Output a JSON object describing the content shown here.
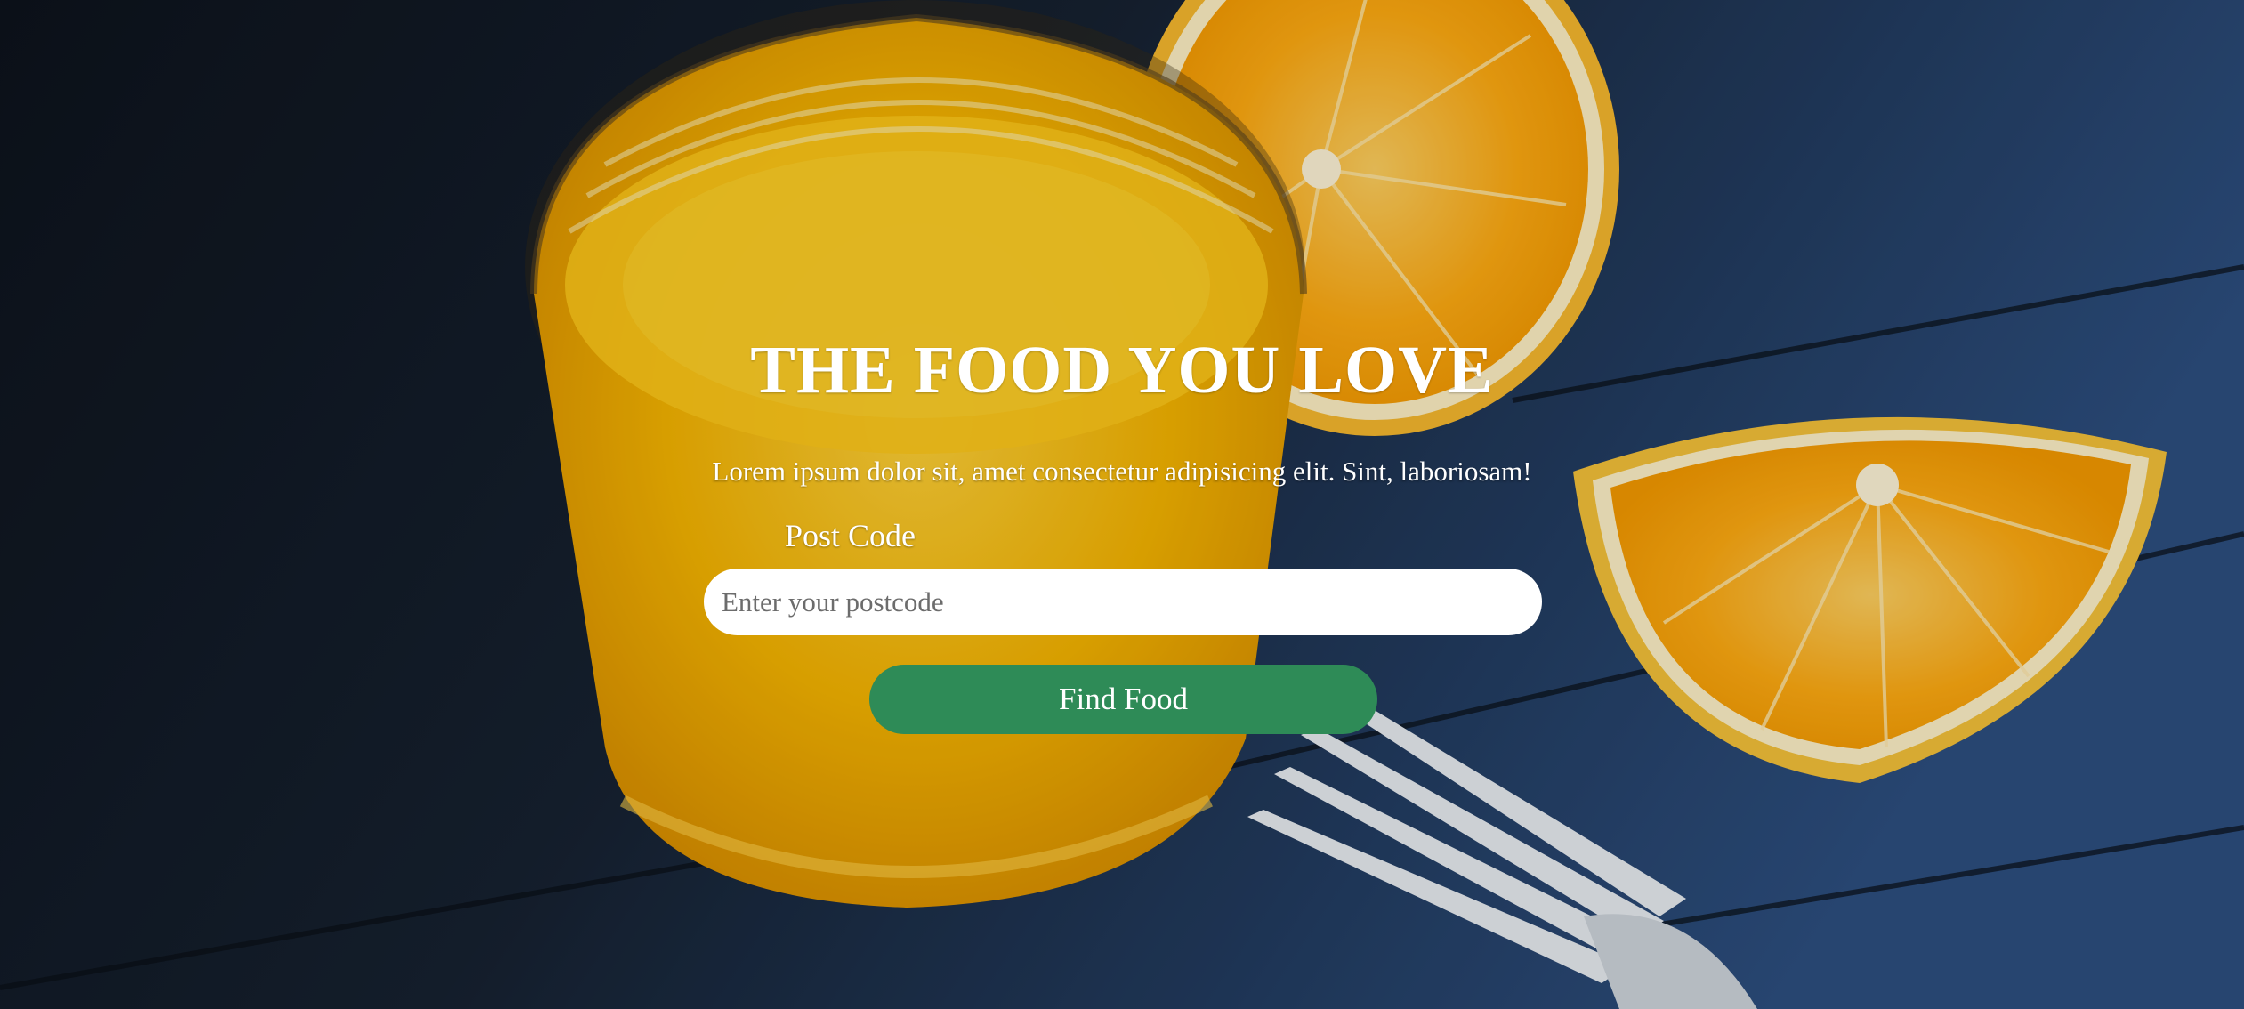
{
  "hero": {
    "title": "THE FOOD YOU LOVE",
    "subtitle": "Lorem ipsum dolor sit, amet consectetur adipisicing elit. Sint, laboriosam!"
  },
  "search_form": {
    "postcode_label": "Post Code",
    "postcode_placeholder": "Enter your postcode",
    "postcode_value": "",
    "submit_label": "Find Food"
  },
  "colors": {
    "button_green": "#2e8b57",
    "orange": "#f5a300",
    "background_dark": "#111823",
    "table_blue": "#2b4b7a"
  },
  "background_image": {
    "depicts": [
      "glass-of-orange-juice",
      "orange-halves",
      "fork",
      "blue-wooden-table"
    ]
  }
}
